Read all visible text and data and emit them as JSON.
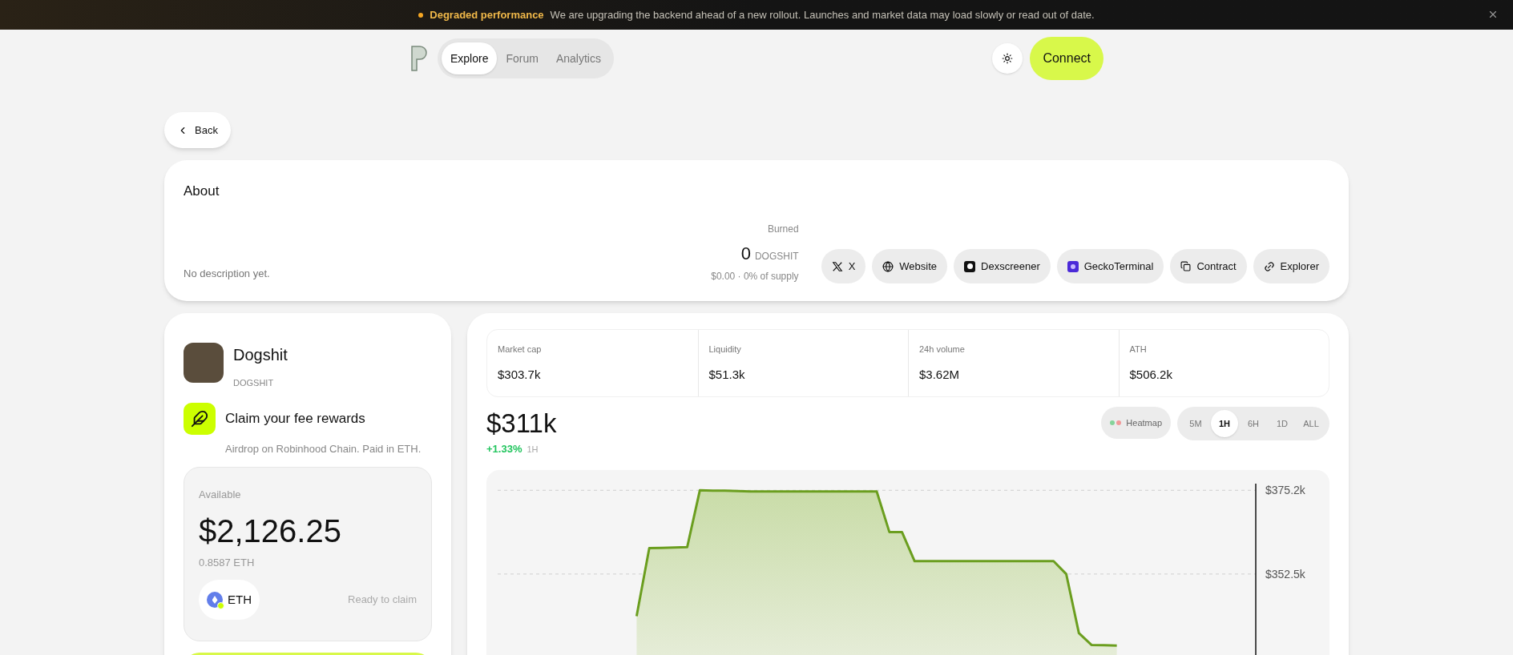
{
  "banner": {
    "title": "Degraded performance",
    "message": "We are upgrading the backend ahead of a new rollout. Launches and market data may load slowly or read out of date."
  },
  "nav": {
    "tabs": [
      {
        "label": "Explore",
        "selected": true
      },
      {
        "label": "Forum",
        "selected": false
      },
      {
        "label": "Analytics",
        "selected": false
      }
    ],
    "connect": "Connect"
  },
  "back": "Back",
  "about": {
    "title": "About",
    "description": "No description yet.",
    "burned": {
      "label": "Burned",
      "amount": "0",
      "symbol": "DOGSHIT",
      "detail": "$0.00 · 0% of supply"
    },
    "links": [
      {
        "kind": "x",
        "label": "X"
      },
      {
        "kind": "website",
        "label": "Website"
      },
      {
        "kind": "dexscreener",
        "label": "Dexscreener"
      },
      {
        "kind": "gecko",
        "label": "GeckoTerminal"
      },
      {
        "kind": "contract",
        "label": "Contract"
      },
      {
        "kind": "explorer",
        "label": "Explorer"
      }
    ]
  },
  "token": {
    "name": "Dogshit",
    "symbol": "DOGSHIT"
  },
  "rewards": {
    "title": "Claim your fee rewards",
    "subtitle": "Airdrop on Robinhood Chain. Paid in ETH.",
    "available_label": "Available",
    "amount": "$2,126.25",
    "eth": "0.8587 ETH",
    "asset": "ETH",
    "status": "Ready to claim"
  },
  "stats": [
    {
      "label": "Market cap",
      "value": "$303.7k"
    },
    {
      "label": "Liquidity",
      "value": "$51.3k"
    },
    {
      "label": "24h volume",
      "value": "$3.62M"
    },
    {
      "label": "ATH",
      "value": "$506.2k"
    }
  ],
  "price": {
    "value": "$311k",
    "change": "+1.33%",
    "period": "1H"
  },
  "heatmap": "Heatmap",
  "timeframes": [
    {
      "label": "5M",
      "selected": false
    },
    {
      "label": "1H",
      "selected": true
    },
    {
      "label": "6H",
      "selected": false
    },
    {
      "label": "1D",
      "selected": false
    },
    {
      "label": "ALL",
      "selected": false
    }
  ],
  "chart_data": {
    "type": "area",
    "categories": [
      null,
      null,
      null,
      null,
      null,
      null,
      null,
      null,
      null,
      null,
      null,
      null,
      null,
      null,
      null,
      null,
      null,
      null,
      null,
      null,
      null,
      null,
      null,
      null,
      null,
      null,
      null,
      null,
      null,
      null,
      null,
      null,
      null,
      null,
      null,
      null,
      null,
      null,
      null,
      null,
      null,
      null,
      null,
      null,
      null,
      null,
      null,
      null,
      null,
      null,
      null,
      null,
      null,
      null,
      null,
      null,
      null,
      null,
      null,
      null,
      null
    ],
    "series": [
      {
        "color": "#6b9e1f",
        "values": [
          null,
          null,
          null,
          null,
          null,
          null,
          null,
          null,
          null,
          null,
          null,
          341.1,
          359.5,
          359.6,
          359.7,
          359.8,
          375.2,
          375.1,
          375.1,
          375.0,
          374.9,
          374.9,
          374.9,
          374.9,
          374.9,
          374.9,
          374.9,
          374.9,
          374.9,
          374.9,
          374.9,
          363.9,
          363.9,
          356.0,
          356.0,
          356.0,
          356.0,
          356.0,
          356.0,
          356.0,
          356.0,
          356.0,
          356.0,
          356.0,
          356.0,
          352.5,
          336.5,
          333.3,
          333.2,
          333.1,
          null,
          null,
          null,
          null,
          null,
          null,
          null,
          null,
          null,
          null,
          null
        ]
      }
    ],
    "ylim": [
      326,
      377
    ],
    "yticks": [
      {
        "value": 375.2,
        "label": "$375.2k"
      },
      {
        "value": 352.5,
        "label": "$352.5k"
      }
    ]
  }
}
